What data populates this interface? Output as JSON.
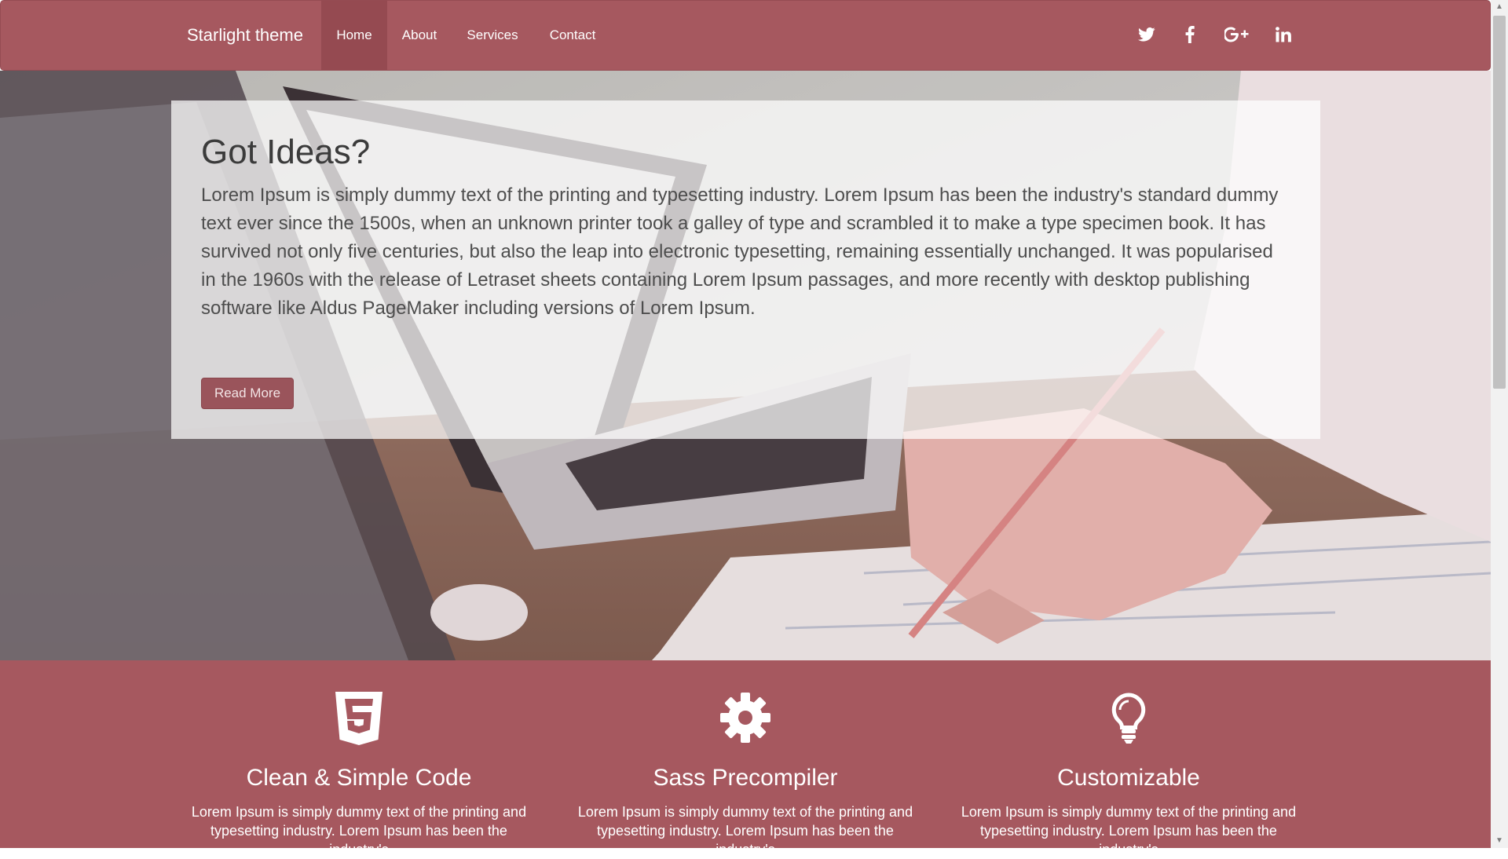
{
  "navbar": {
    "brand": "Starlight theme",
    "items": [
      {
        "label": "Home",
        "active": true
      },
      {
        "label": "About",
        "active": false
      },
      {
        "label": "Services",
        "active": false
      },
      {
        "label": "Contact",
        "active": false
      }
    ],
    "social": [
      "twitter-icon",
      "facebook-icon",
      "google-plus-icon",
      "linkedin-icon"
    ],
    "color": "#a6585f"
  },
  "hero": {
    "title": "Got Ideas?",
    "text": "Lorem Ipsum is simply dummy text of the printing and typesetting industry. Lorem Ipsum has been the industry's standard dummy text ever since the 1500s, when an unknown printer took a galley of type and scrambled it to make a type specimen book. It has survived not only five centuries, but also the leap into electronic typesetting, remaining essentially unchanged. It was popularised in the 1960s with the release of Letraset sheets containing Lorem Ipsum passages, and more recently with desktop publishing software like Aldus PageMaker including versions of Lorem Ipsum.",
    "button": "Read More"
  },
  "features": [
    {
      "icon": "html5-icon",
      "title": "Clean & Simple Code",
      "text": "Lorem Ipsum is simply dummy text of the printing and typesetting industry. Lorem Ipsum has been the industry's"
    },
    {
      "icon": "gear-icon",
      "title": "Sass Precompiler",
      "text": "Lorem Ipsum is simply dummy text of the printing and typesetting industry. Lorem Ipsum has been the industry's"
    },
    {
      "icon": "lightbulb-icon",
      "title": "Customizable",
      "text": "Lorem Ipsum is simply dummy text of the printing and typesetting industry. Lorem Ipsum has been the industry's"
    }
  ],
  "colors": {
    "accent": "#a6585f",
    "active_nav": "#954a51",
    "button": "#9a545b"
  }
}
